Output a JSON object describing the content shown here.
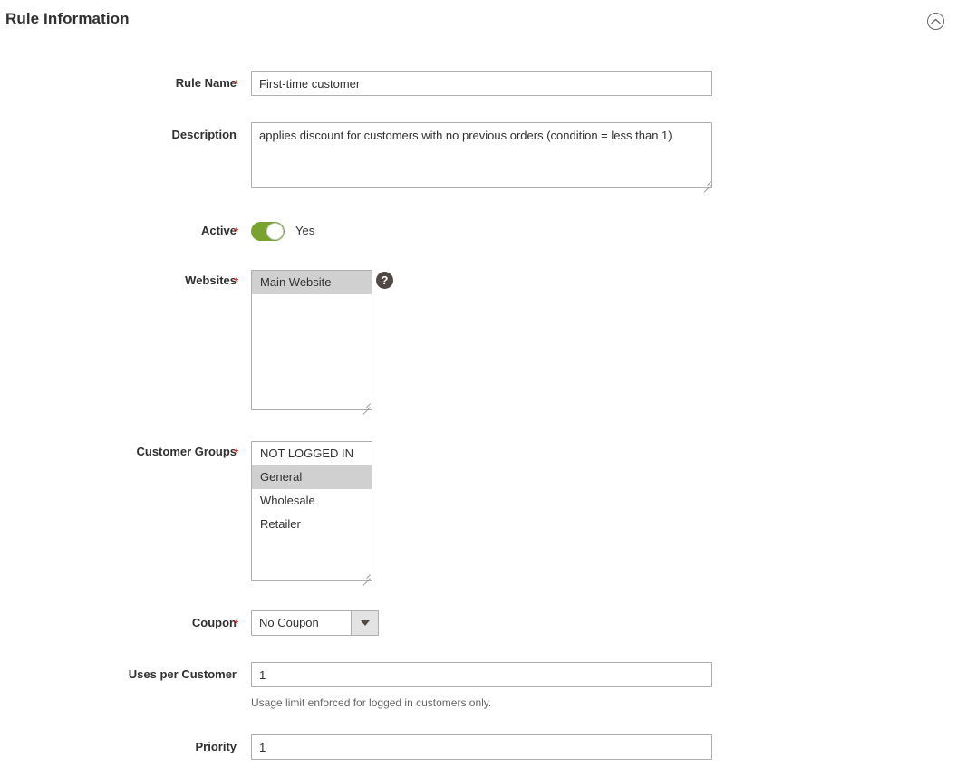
{
  "section": {
    "title": "Rule Information",
    "collapse_icon": "chevron-up-circle-icon"
  },
  "fields": {
    "rule_name": {
      "label": "Rule Name",
      "required_marker": "*",
      "value": "First-time customer"
    },
    "description": {
      "label": "Description",
      "value": "applies discount for customers with no previous orders (condition = less than 1)"
    },
    "active": {
      "label": "Active",
      "required_marker": "*",
      "state_label": "Yes",
      "on": true,
      "on_color": "#79a22e"
    },
    "websites": {
      "label": "Websites",
      "required_marker": "*",
      "help_icon": "question-mark-icon",
      "options": [
        {
          "label": "Main Website",
          "selected": true
        }
      ]
    },
    "customer_groups": {
      "label": "Customer Groups",
      "required_marker": "*",
      "options": [
        {
          "label": "NOT LOGGED IN",
          "selected": false
        },
        {
          "label": "General",
          "selected": true
        },
        {
          "label": "Wholesale",
          "selected": false
        },
        {
          "label": "Retailer",
          "selected": false
        }
      ]
    },
    "coupon": {
      "label": "Coupon",
      "required_marker": "*",
      "value": "No Coupon",
      "arrow_icon": "chevron-down-icon"
    },
    "uses_per_customer": {
      "label": "Uses per Customer",
      "value": "1",
      "note": "Usage limit enforced for logged in customers only."
    },
    "priority": {
      "label": "Priority",
      "value": "1"
    }
  }
}
